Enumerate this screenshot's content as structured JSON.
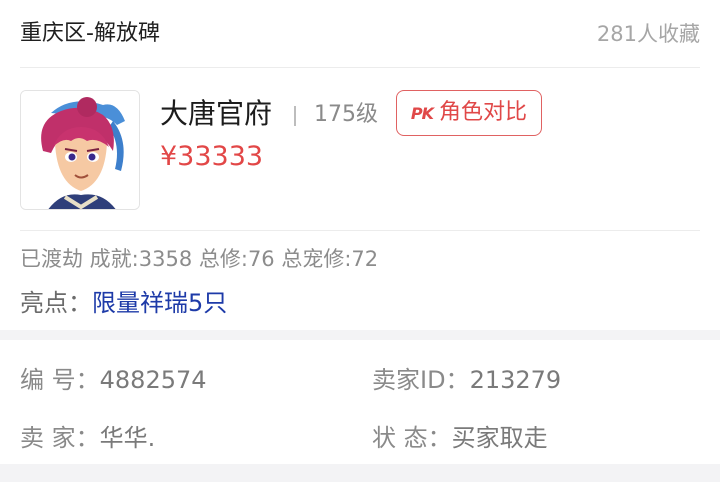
{
  "header": {
    "server": "重庆区-解放碑",
    "favorites": "281人收藏"
  },
  "role": {
    "avatar_icon": "character-portrait",
    "name": "大唐官府",
    "level": "175级",
    "compare_icon": "pk-icon",
    "compare_label": "角色对比",
    "price": "¥33333"
  },
  "stats": "已渡劫 成就:3358 总修:76 总宠修:72",
  "highlight": {
    "label": "亮点：",
    "value": "限量祥瑞5只"
  },
  "details": {
    "id_label": "编  号：",
    "id_value": "4882574",
    "seller_id_label": "卖家ID：",
    "seller_id_value": "213279",
    "seller_label": "卖  家：",
    "seller_value": "华华.",
    "status_label": "状  态：",
    "status_value": "买家取走"
  },
  "colors": {
    "price": "#e24747",
    "accent_red": "#e04848",
    "highlight_blue": "#1d3aa8"
  }
}
